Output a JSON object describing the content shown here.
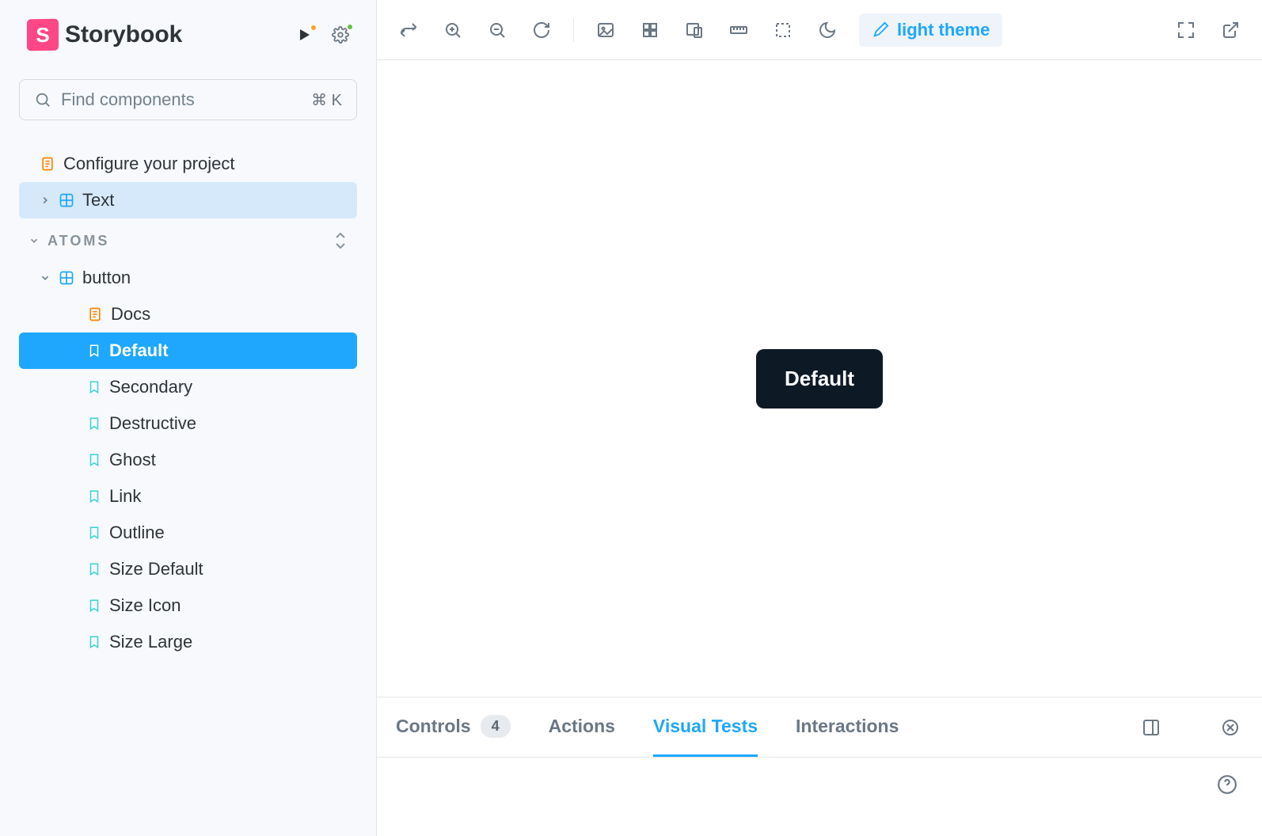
{
  "sidebar": {
    "logo_text": "Storybook",
    "search_placeholder": "Find components",
    "search_shortcut": "⌘ K",
    "configure_label": "Configure your project",
    "text_label": "Text",
    "section_atoms": "ATOMS",
    "button_group": "button",
    "docs_label": "Docs",
    "stories": [
      "Default",
      "Secondary",
      "Destructive",
      "Ghost",
      "Link",
      "Outline",
      "Size Default",
      "Size Icon",
      "Size Large"
    ]
  },
  "toolbar": {
    "theme_label": "light theme"
  },
  "canvas": {
    "button_text": "Default"
  },
  "addons": {
    "controls_label": "Controls",
    "controls_count": "4",
    "actions_label": "Actions",
    "visual_tests_label": "Visual Tests",
    "interactions_label": "Interactions"
  }
}
